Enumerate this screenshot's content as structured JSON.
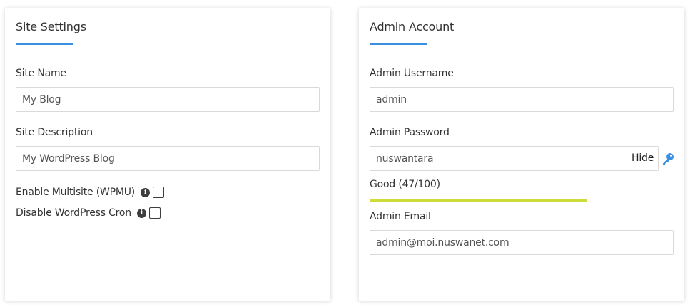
{
  "site_settings": {
    "title": "Site Settings",
    "site_name": {
      "label": "Site Name",
      "value": "My Blog"
    },
    "site_description": {
      "label": "Site Description",
      "value": "My WordPress Blog"
    },
    "enable_multisite": {
      "label": "Enable Multisite (WPMU)",
      "checked": false
    },
    "disable_cron": {
      "label": "Disable WordPress Cron",
      "checked": false
    }
  },
  "admin_account": {
    "title": "Admin Account",
    "username": {
      "label": "Admin Username",
      "value": "admin"
    },
    "password": {
      "label": "Admin Password",
      "value": "nuswantara",
      "toggle_label": "Hide",
      "strength_text": "Good (47/100)",
      "strength_fraction": 1.0,
      "strength_color": "#cddc39"
    },
    "email": {
      "label": "Admin Email",
      "value": "admin@moi.nuswanet.com"
    }
  },
  "icons": {
    "info": "info-icon",
    "key": "key-icon"
  },
  "colors": {
    "accent": "#3b8fe1",
    "strength_good": "#cddc39"
  }
}
